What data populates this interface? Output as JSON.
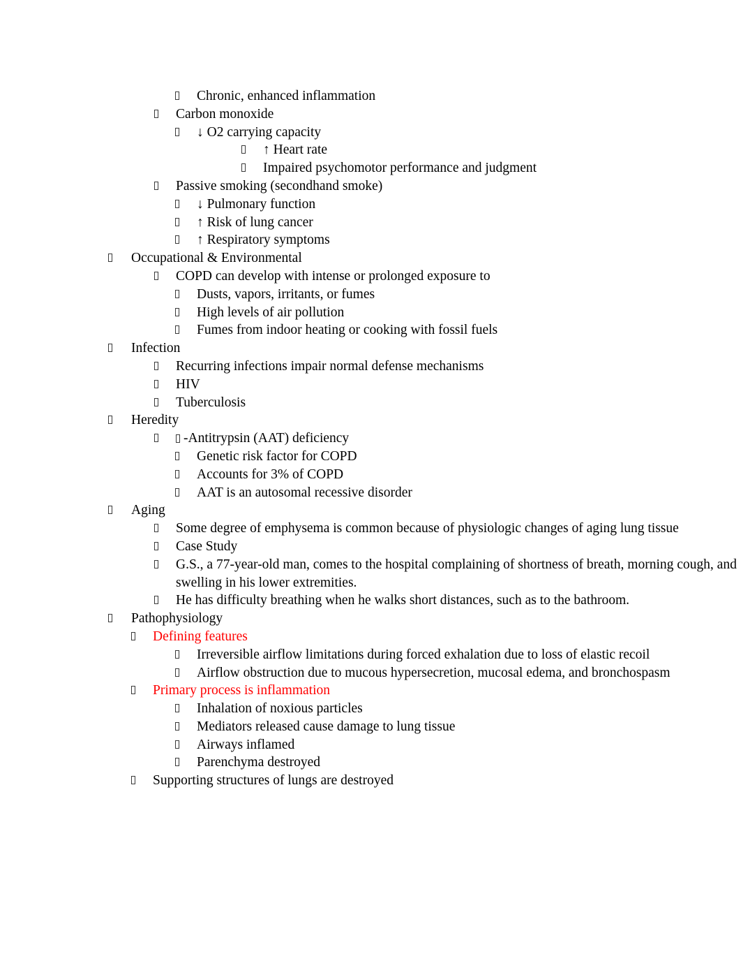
{
  "document": {
    "type": "outline-notes",
    "topic": "COPD",
    "background_color": "#FFFFFF",
    "text_color": "#000000",
    "accent_color": "#FF0000",
    "bullet_glyph": "missing-glyph-box"
  },
  "outline": [
    {
      "level": 3,
      "text": "Chronic, enhanced inflammation",
      "color": "#000000"
    },
    {
      "level": 2,
      "text": "Carbon monoxide",
      "color": "#000000"
    },
    {
      "level": 3,
      "text": "↓ O2 carrying capacity",
      "color": "#000000"
    },
    {
      "level": 4,
      "text": "↑ Heart rate",
      "color": "#000000"
    },
    {
      "level": 4,
      "text": "Impaired psychomotor performance and judgment",
      "color": "#000000"
    },
    {
      "level": 2,
      "text": "Passive smoking (secondhand smoke)",
      "color": "#000000"
    },
    {
      "level": 3,
      "text": "↓ Pulmonary function",
      "color": "#000000"
    },
    {
      "level": 3,
      "text": "↑ Risk of lung cancer",
      "color": "#000000"
    },
    {
      "level": 3,
      "text": "↑ Respiratory symptoms",
      "color": "#000000"
    },
    {
      "level": 1,
      "text": "Occupational & Environmental",
      "color": "#000000"
    },
    {
      "level": 2,
      "text": "COPD can develop with intense or prolonged exposure to",
      "color": "#000000"
    },
    {
      "level": 3,
      "text": "Dusts, vapors, irritants, or fumes",
      "color": "#000000"
    },
    {
      "level": 3,
      "text": "High levels of air pollution",
      "color": "#000000"
    },
    {
      "level": 3,
      "text": "Fumes from indoor heating or cooking with fossil fuels",
      "color": "#000000"
    },
    {
      "level": 1,
      "text": "Infection",
      "color": "#000000"
    },
    {
      "level": 2,
      "text": "Recurring infections impair normal defense mechanisms",
      "color": "#000000"
    },
    {
      "level": 2,
      "text": "HIV",
      "color": "#000000"
    },
    {
      "level": 2,
      "text": "Tuberculosis",
      "color": "#000000"
    },
    {
      "level": 1,
      "text": "Heredity",
      "color": "#000000"
    },
    {
      "level": 2,
      "text": "-Antitrypsin (AAT) deficiency",
      "color": "#000000",
      "leading_missing_glyph": true
    },
    {
      "level": 3,
      "text": "Genetic risk factor for COPD",
      "color": "#000000"
    },
    {
      "level": 3,
      "text": "Accounts for 3% of COPD",
      "color": "#000000"
    },
    {
      "level": 3,
      "text": "AAT is an autosomal recessive disorder",
      "color": "#000000"
    },
    {
      "level": 1,
      "text": "Aging",
      "color": "#000000"
    },
    {
      "level": 2,
      "text": "Some degree of emphysema is common because of physiologic changes of aging lung tissue",
      "color": "#000000"
    },
    {
      "level": 2,
      "text": "Case Study",
      "color": "#000000"
    },
    {
      "level": 2,
      "text": "G.S., a 77-year-old man, comes to the hospital complaining of shortness of breath, morning cough, and swelling in his lower extremities.",
      "color": "#000000"
    },
    {
      "level": 2,
      "text": "He has difficulty breathing when he walks short distances, such as to the bathroom.",
      "color": "#000000"
    },
    {
      "level": 1,
      "text": "Pathophysiology",
      "color": "#000000"
    },
    {
      "level": "2b",
      "text": "Defining features",
      "color": "#FF0000"
    },
    {
      "level": 3,
      "text": "Irreversible airflow limitations during forced exhalation due to loss of elastic recoil",
      "color": "#000000"
    },
    {
      "level": 3,
      "text": "Airflow obstruction due to mucous hypersecretion, mucosal edema, and bronchospasm",
      "color": "#000000"
    },
    {
      "level": "2b",
      "text": "Primary process is inflammation",
      "color": "#FF0000"
    },
    {
      "level": 3,
      "text": "Inhalation of noxious particles",
      "color": "#000000"
    },
    {
      "level": 3,
      "text": "Mediators released cause damage to lung tissue",
      "color": "#000000"
    },
    {
      "level": 3,
      "text": "Airways inflamed",
      "color": "#000000"
    },
    {
      "level": 3,
      "text": "Parenchyma destroyed",
      "color": "#000000"
    },
    {
      "level": "2b",
      "text": "Supporting structures of lungs are destroyed",
      "color": "#000000"
    }
  ]
}
